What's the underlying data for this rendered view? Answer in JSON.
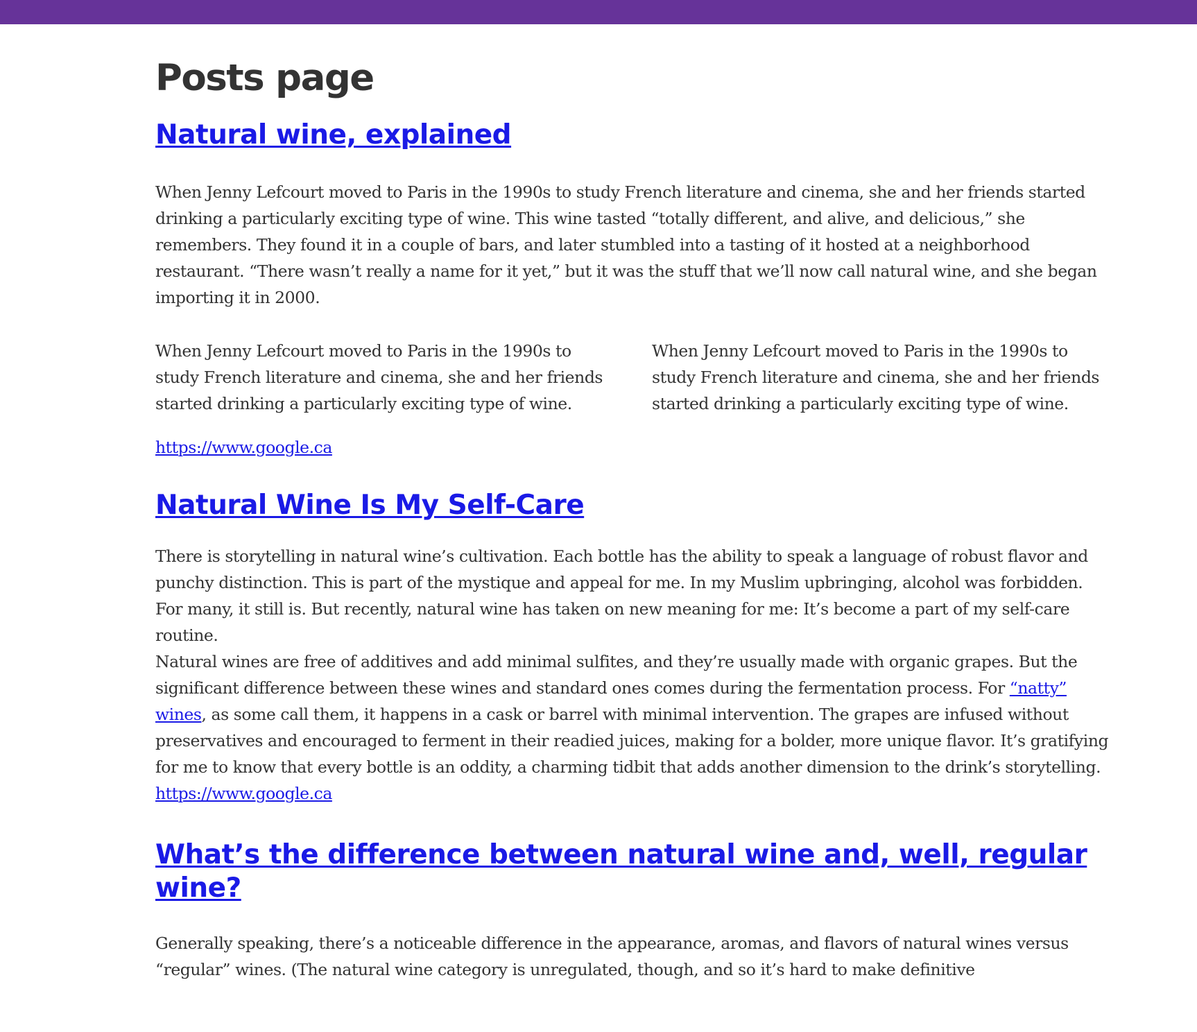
{
  "page": {
    "title": "Posts page",
    "accent_color": "#663399",
    "link_color": "#1a1ae6"
  },
  "posts": [
    {
      "title": "Natural wine, explained",
      "body": "When Jenny Lefcourt moved to Paris in the 1990s to study French literature and cinema, she and her friends started drinking a particularly exciting type of wine. This wine tasted “totally different, and alive, and delicious,” she remembers. They found it in a couple of bars, and later stumbled into a tasting of it hosted at a neighborhood restaurant. “There wasn’t really a name for it yet,” but it was the stuff that we’ll now call natural wine, and she began importing it in 2000.",
      "columns": [
        "When Jenny Lefcourt moved to Paris in the 1990s to study French literature and cinema, she and her friends started drinking a particularly exciting type of wine.",
        "When Jenny Lefcourt moved to Paris in the 1990s to study French literature and cinema, she and her friends started drinking a particularly exciting type of wine."
      ],
      "link": "https://www.google.ca"
    },
    {
      "title": "Natural Wine Is My Self-Care",
      "paragraph1": "There is storytelling in natural wine’s cultivation. Each bottle has the ability to speak a language of robust flavor and punchy distinction. This is part of the mystique and appeal for me. In my Muslim upbringing, alcohol was forbidden. For many, it still is. But recently, natural wine has taken on new meaning for me: It’s become a part of my self-care routine.",
      "paragraph2_before": "Natural wines are free of additives and add minimal sulfites, and they’re usually made with organic grapes. But the significant difference between these wines and standard ones comes during the fermentation process. For ",
      "paragraph2_link": "“natty” wines",
      "paragraph2_after": ", as some call them, it happens in a cask or barrel with minimal intervention. The grapes are infused without preservatives and encouraged to ferment in their readied juices, making for a bolder, more unique flavor. It’s gratifying for me to know that every bottle is an oddity, a charming tidbit that adds another dimension to the drink’s storytelling.",
      "link": "https://www.google.ca"
    },
    {
      "title": "What’s the difference between natural wine and, well, regular wine?",
      "body": "Generally speaking, there’s a noticeable difference in the appearance, aromas, and flavors of natural wines versus “regular” wines. (The natural wine category is unregulated, though, and so it’s hard to make definitive"
    }
  ]
}
